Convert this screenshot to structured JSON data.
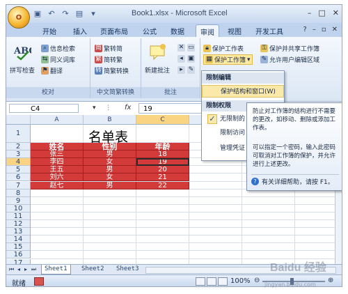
{
  "window": {
    "title": "Book1.xlsx - Microsoft Excel",
    "office_button": "O",
    "controls": [
      "–",
      "□",
      "✕"
    ]
  },
  "ribbon_tabs": [
    "开始",
    "插入",
    "页面布局",
    "公式",
    "数据",
    "审阅",
    "视图",
    "开发工具"
  ],
  "active_tab": "审阅",
  "ribbon_right": [
    "?",
    "–",
    "▫",
    "✕"
  ],
  "groups": {
    "proofing": {
      "label": "校对",
      "spell": "拼写检查",
      "research": "信息检索",
      "thesaurus": "同义词库",
      "translate": "翻译"
    },
    "chinese": {
      "label": "中文简繁转换",
      "to_simplified": "繁转简",
      "to_traditional": "简转繁",
      "convert": "简繁转换"
    },
    "comments": {
      "label": "批注",
      "new_comment": "新建批注"
    },
    "changes": {
      "protect_sheet": "保护工作表",
      "protect_workbook": "保护工作簿",
      "protect_share": "保护并共享工作簿",
      "allow_edit": "允许用户编辑区域"
    }
  },
  "formula_bar": {
    "name_box": "C4",
    "fx": "fx",
    "value": "19"
  },
  "columns": [
    "A",
    "B",
    "C"
  ],
  "rows": [
    "1",
    "2",
    "3",
    "4",
    "5",
    "6",
    "7",
    "8",
    "9",
    "10",
    "11",
    "12",
    "13",
    "14",
    "15",
    "16",
    "17",
    "18"
  ],
  "sheet": {
    "title": "名单表",
    "headers": [
      "姓名",
      "性别",
      "年龄"
    ],
    "data": [
      [
        "张三",
        "男",
        "18"
      ],
      [
        "李四",
        "女",
        "19"
      ],
      [
        "王五",
        "男",
        "20"
      ],
      [
        "刘六",
        "女",
        "21"
      ],
      [
        "赵七",
        "男",
        "22"
      ]
    ]
  },
  "dropdown": {
    "section1": "限制编辑",
    "item_protect": "保护结构和窗口(W)",
    "section2": "限制权限",
    "item_unrestricted": "无限制的",
    "item_restricted": "限制访问",
    "item_manage": "管理凭证"
  },
  "tooltip": {
    "p1": "防止对工作簿的结构进行不需要的更改，如移动、删除或添加工作表。",
    "p2": "可以指定一个密码，输入此密码可取消对工作簿的保护，并允许进行上述更改。",
    "help": "有关详细帮助，请按 F1。"
  },
  "sheet_tabs": [
    "Sheet1",
    "Sheet2",
    "Sheet3"
  ],
  "status": {
    "ready": "就绪",
    "zoom": "100%"
  },
  "watermark": {
    "text": "Baidu 经验",
    "url": "jingyan.baidu.com"
  },
  "colors": {
    "red_fill": "#d33b3b",
    "ribbon": "#dbe6f4",
    "highlight": "#fbe9a9"
  }
}
